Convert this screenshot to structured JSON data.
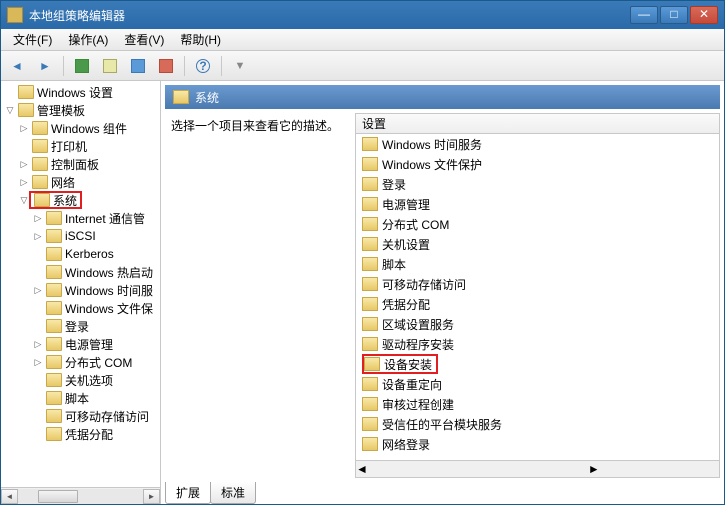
{
  "window": {
    "title": "本地组策略编辑器",
    "btn_min": "—",
    "btn_max": "□",
    "btn_close": "✕"
  },
  "menu": {
    "file": "文件(F)",
    "action": "操作(A)",
    "view": "查看(V)",
    "help": "帮助(H)"
  },
  "tree": {
    "windows_settings": "Windows 设置",
    "admin_templates": "管理模板",
    "windows_components": "Windows 组件",
    "printers": "打印机",
    "control_panel": "控制面板",
    "network": "网络",
    "system": "系统",
    "internet_comm": "Internet 通信管",
    "iscsi": "iSCSI",
    "kerberos": "Kerberos",
    "windows_hotstart": "Windows 热启动",
    "windows_time": "Windows 时间服",
    "windows_file_prot": "Windows 文件保",
    "logon": "登录",
    "power_mgmt": "电源管理",
    "dcom": "分布式 COM",
    "shutdown_opts": "关机选项",
    "scripts": "脚本",
    "removable_storage": "可移动存储访问",
    "cred_deleg": "凭据分配"
  },
  "content": {
    "header": "系统",
    "desc_prompt": "选择一个项目来查看它的描述。",
    "list_header": "设置",
    "items": [
      "Windows 时间服务",
      "Windows 文件保护",
      "登录",
      "电源管理",
      "分布式 COM",
      "关机设置",
      "脚本",
      "可移动存储访问",
      "凭据分配",
      "区域设置服务",
      "驱动程序安装",
      "设备安装",
      "设备重定向",
      "审核过程创建",
      "受信任的平台模块服务",
      "网络登录"
    ],
    "highlighted_index": 11
  },
  "tabs": {
    "extended": "扩展",
    "standard": "标准"
  },
  "scroll": {
    "left": "◄",
    "right": "►"
  }
}
